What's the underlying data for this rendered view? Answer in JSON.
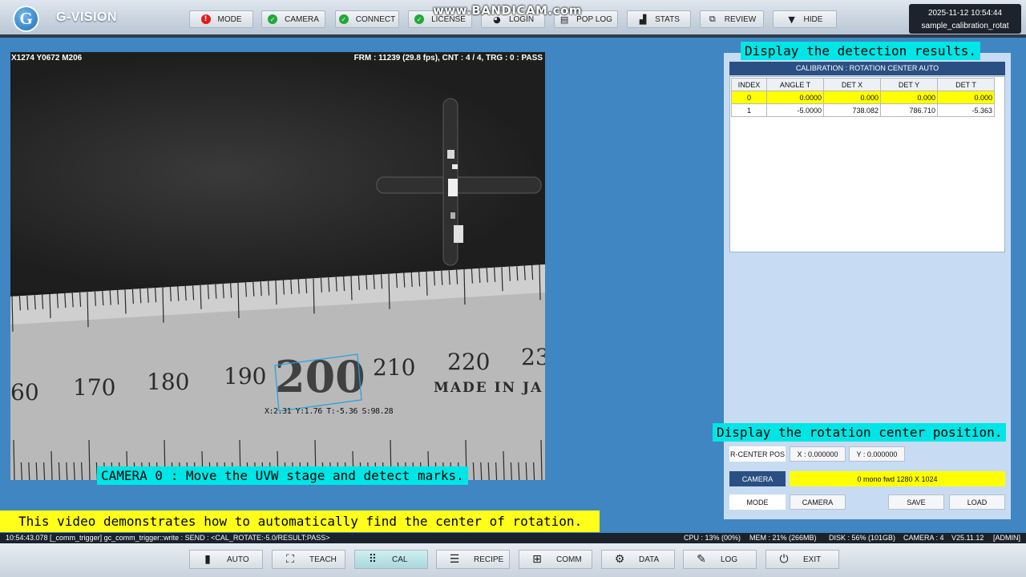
{
  "app": {
    "logo_letter": "G",
    "title": "G-VISION"
  },
  "watermark": "www.BANDICAM.com",
  "toolbar": [
    {
      "label": "MODE",
      "icon": "error-icon"
    },
    {
      "label": "CAMERA",
      "icon": "check-icon"
    },
    {
      "label": "CONNECT",
      "icon": "check-icon"
    },
    {
      "label": "LICENSE",
      "icon": "check-icon"
    },
    {
      "label": "LOGIN",
      "icon": "user-icon"
    },
    {
      "label": "POP LOG",
      "icon": "document-icon"
    },
    {
      "label": "STATS",
      "icon": "bar-chart-icon"
    },
    {
      "label": "REVIEW",
      "icon": "review-icon"
    },
    {
      "label": "HIDE",
      "icon": "triangle-down-icon"
    }
  ],
  "datetime": "2025-11-12 10:54:44",
  "recipe_name": "sample_calibration_rotat",
  "camera_view": {
    "coords": "X1274 Y0672 M206",
    "frame_info": "FRM : 11239 (29.8 fps), CNT : 4 / 4, TRG : 0 : PASS",
    "detection_label": "X:2.31 Y:1.76 T:-5.36 S:98.28",
    "ruler_numbers": [
      "60",
      "170",
      "180",
      "190",
      "200",
      "210",
      "220",
      "23"
    ],
    "ruler_text": "MADE IN JA"
  },
  "captions": {
    "detection_results": "Display the detection results.",
    "rotation_center": "Display the rotation center position.",
    "camera_note": "CAMERA 0 : Move the UVW stage and detect marks.",
    "video_note": "This video demonstrates how to automatically find the center of rotation."
  },
  "panel": {
    "title": "CALIBRATION : ROTATION CENTER  AUTO",
    "columns": [
      "INDEX",
      "ANGLE T",
      "DET X",
      "DET Y",
      "DET T"
    ],
    "rows": [
      [
        "0",
        "0.0000",
        "0.000",
        "0.000",
        "0.000"
      ],
      [
        "1",
        "-5.0000",
        "738.082",
        "786.710",
        "-5.363"
      ]
    ],
    "rcenter_label": "R-CENTER POS",
    "rcenter_x": "X : 0.000000",
    "rcenter_y": "Y : 0.000000",
    "camera_label": "CAMERA",
    "camera_status": "0 mono fwd  1280 X 1024",
    "mode_label": "MODE",
    "camera_button": "CAMERA",
    "save_button": "SAVE",
    "load_button": "LOAD"
  },
  "status_bar": {
    "log": "10:54:43.078  [_comm_trigger] gc_comm_trigger::write : SEND : <CAL_ROTATE:-5.0/RESULT:PASS>",
    "cpu": "CPU : 13% (00%)",
    "mem": "MEM : 21% (266MB)",
    "disk": "DISK : 56% (101GB)",
    "camera": "CAMERA : 4",
    "version": "V25.11.12",
    "user": "[ADMIN]"
  },
  "bottom_nav": [
    {
      "label": "AUTO",
      "icon": "auto-icon"
    },
    {
      "label": "TEACH",
      "icon": "teach-icon"
    },
    {
      "label": "CAL",
      "icon": "grid-icon"
    },
    {
      "label": "RECIPE",
      "icon": "database-icon"
    },
    {
      "label": "COMM",
      "icon": "network-icon"
    },
    {
      "label": "DATA",
      "icon": "gear-icon"
    },
    {
      "label": "LOG",
      "icon": "log-icon"
    },
    {
      "label": "EXIT",
      "icon": "power-icon"
    }
  ],
  "colors": {
    "accent_blue": "#3f86c2",
    "highlight_yellow": "#ffff00",
    "caption_cyan": "#00e6e6",
    "panel_title": "#2a4f82"
  }
}
